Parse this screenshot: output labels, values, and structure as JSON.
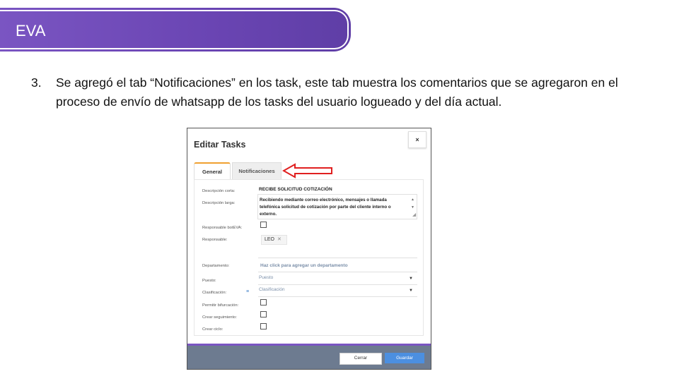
{
  "slide": {
    "header_title": "EVA",
    "item_number": "3.",
    "paragraph": "Se agregó el tab “Notificaciones” en los task, este tab muestra los comentarios que se agregaron en el proceso de envío de whatsapp de los tasks del usuario logueado y del día actual."
  },
  "dialog": {
    "title": "Editar Tasks",
    "close_glyph": "×",
    "tabs": [
      {
        "label": "General",
        "active": true
      },
      {
        "label": "Notificaciones",
        "active": false
      }
    ],
    "fields": {
      "descripcion_corta_label": "Descripción corta:",
      "descripcion_corta_value": "RECIBE SOLICITUD COTIZACIÓN",
      "descripcion_larga_label": "Descripción larga:",
      "descripcion_larga_value": "Recibiendo mediante correo electrónico, mensajes o llamada telefónica solicitud de cotización por parte del cliente interno o externo.",
      "responsable_boteva_label": "Responsable botEVA:",
      "responsable_label": "Responsable:",
      "responsable_tag": "LEO",
      "departamento_label": "Departamento:",
      "departamento_placeholder": "Haz click para agregar un departamento",
      "puesto_label": "Puesto:",
      "puesto_placeholder": "Puesto",
      "clasificacion_label": "Clasificación:",
      "clasificacion_placeholder": "Clasificación",
      "permitir_bifurcacion_label": "Permitir bifurcación:",
      "crear_seguimiento_label": "Crear seguimiento:",
      "crear_ciclo_label": "Crear ciclo:"
    },
    "buttons": {
      "cerrar": "Cerrar",
      "guardar": "Guardar"
    }
  },
  "colors": {
    "banner_purple": "#6a45b3",
    "active_tab_accent": "#f0a030",
    "annotation_arrow": "#e02020",
    "save_button": "#4c8fe0",
    "footer": "#6d7b90"
  }
}
